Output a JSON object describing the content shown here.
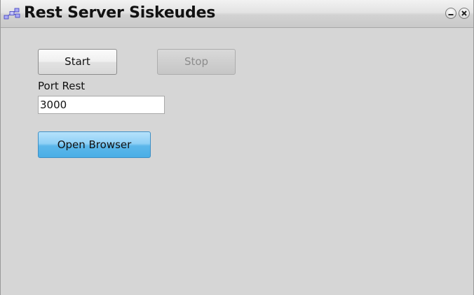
{
  "window": {
    "title": "Rest Server Siskeudes",
    "app_icon": "network-nodes-icon",
    "minimize_icon": "minimize-icon",
    "close_icon": "close-icon"
  },
  "form": {
    "start_label": "Start",
    "stop_label": "Stop",
    "port_label": "Port Rest",
    "port_value": "3000",
    "open_browser_label": "Open Browser"
  },
  "colors": {
    "accent_button": "#5cb7ea",
    "disabled_text": "#8c8c8c",
    "background": "#d6d6d6"
  }
}
